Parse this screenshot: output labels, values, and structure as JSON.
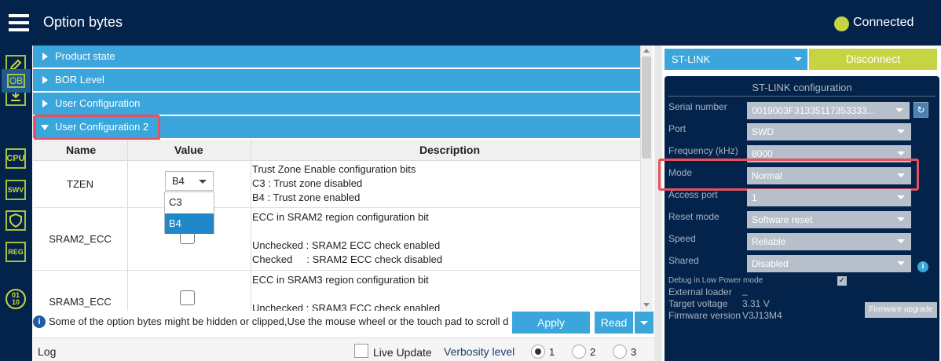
{
  "app": {
    "title": "Option bytes",
    "connection_status": "Connected"
  },
  "sidebar": {
    "items": [
      {
        "label": "",
        "icon": "edit-icon"
      },
      {
        "label": "",
        "icon": "download-icon"
      },
      {
        "label": "OB",
        "icon": "ob-icon"
      },
      {
        "label": "CPU",
        "icon": "cpu-icon"
      },
      {
        "label": "SWV",
        "icon": "swv-icon"
      },
      {
        "label": "",
        "icon": "shield-icon"
      },
      {
        "label": "REG",
        "icon": "reg-icon"
      }
    ],
    "bottom_icon": "binary-icon",
    "bottom_text": "01\n10"
  },
  "sections": [
    {
      "label": "Product state",
      "expanded": false
    },
    {
      "label": "BOR Level",
      "expanded": false
    },
    {
      "label": "User Configuration",
      "expanded": false
    },
    {
      "label": "User Configuration 2",
      "expanded": true
    }
  ],
  "table": {
    "headers": [
      "Name",
      "Value",
      "Description"
    ],
    "rows": [
      {
        "name": "TZEN",
        "value": "B4",
        "desc": "Trust Zone Enable configuration bits\nC3 : Trust zone disabled\nB4 : Trust zone enabled"
      },
      {
        "name": "SRAM2_ECC",
        "value": "",
        "desc": "ECC in SRAM2 region configuration bit\n\nUnchecked : SRAM2 ECC check enabled\nChecked     : SRAM2 ECC check disabled"
      },
      {
        "name": "SRAM3_ECC",
        "value": "",
        "desc": "ECC in SRAM3 region configuration bit\n\nUnchecked : SRAM3 ECC check enabled"
      }
    ],
    "dropdown_options": [
      "C3",
      "B4"
    ],
    "dropdown_selected": "B4"
  },
  "info_message": "Some of the option bytes might be hidden or clipped,Use the mouse wheel or the touch pad to scroll d",
  "buttons": {
    "apply": "Apply",
    "read": "Read"
  },
  "log": {
    "label": "Log",
    "live_update_label": "Live Update",
    "verbosity_label": "Verbosity level",
    "levels": [
      "1",
      "2",
      "3"
    ],
    "selected_level": "1"
  },
  "right_panel": {
    "interface": "ST-LINK",
    "disconnect_label": "Disconnect",
    "config_title": "ST-LINK configuration",
    "fields": [
      {
        "label": "Serial number",
        "value": "0019003F31335117353333..."
      },
      {
        "label": "Port",
        "value": "SWD"
      },
      {
        "label": "Frequency (kHz)",
        "value": "8000"
      },
      {
        "label": "Mode",
        "value": "Normal"
      },
      {
        "label": "Access port",
        "value": "1"
      },
      {
        "label": "Reset mode",
        "value": "Software reset"
      },
      {
        "label": "Speed",
        "value": "Reliable"
      },
      {
        "label": "Shared",
        "value": "Disabled"
      }
    ],
    "debug_low_power_label": "Debug in Low Power mode",
    "external_loader_label": "External loader",
    "external_loader_value": "_",
    "target_voltage_label": "Target voltage",
    "target_voltage_value": "3.31 V",
    "firmware_version_label": "Firmware version",
    "firmware_version_value": "V3J13M4",
    "firmware_upgrade_label": "Firmware upgrade"
  },
  "colors": {
    "navy": "#03234b",
    "accent_blue": "#3aa6dc",
    "lime": "#c6d443",
    "highlight_red": "#e8505e"
  }
}
